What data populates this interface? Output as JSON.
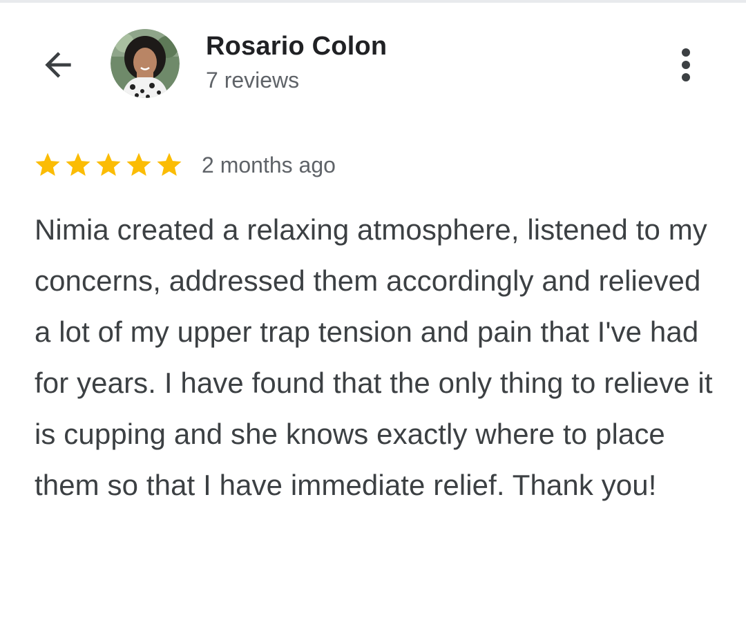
{
  "reviewer": {
    "name": "Rosario Colon",
    "review_count": "7 reviews"
  },
  "header": {
    "back_icon": "arrow-back-icon",
    "menu_icon": "more-vert-icon"
  },
  "review": {
    "rating": 5,
    "max_rating": 5,
    "date": "2 months ago",
    "text": "Nimia created a relaxing atmosphere, listened to my concerns, addressed them accordingly and relieved a lot of my upper trap tension and pain that I've had for years. I have found that the only thing to relieve it is cupping and she knows exactly where to place them so that I have immediate relief. Thank you!"
  },
  "colors": {
    "star": "#fbbc04",
    "text": "#3c4043",
    "secondary_text": "#5f6368",
    "name": "#202124"
  }
}
